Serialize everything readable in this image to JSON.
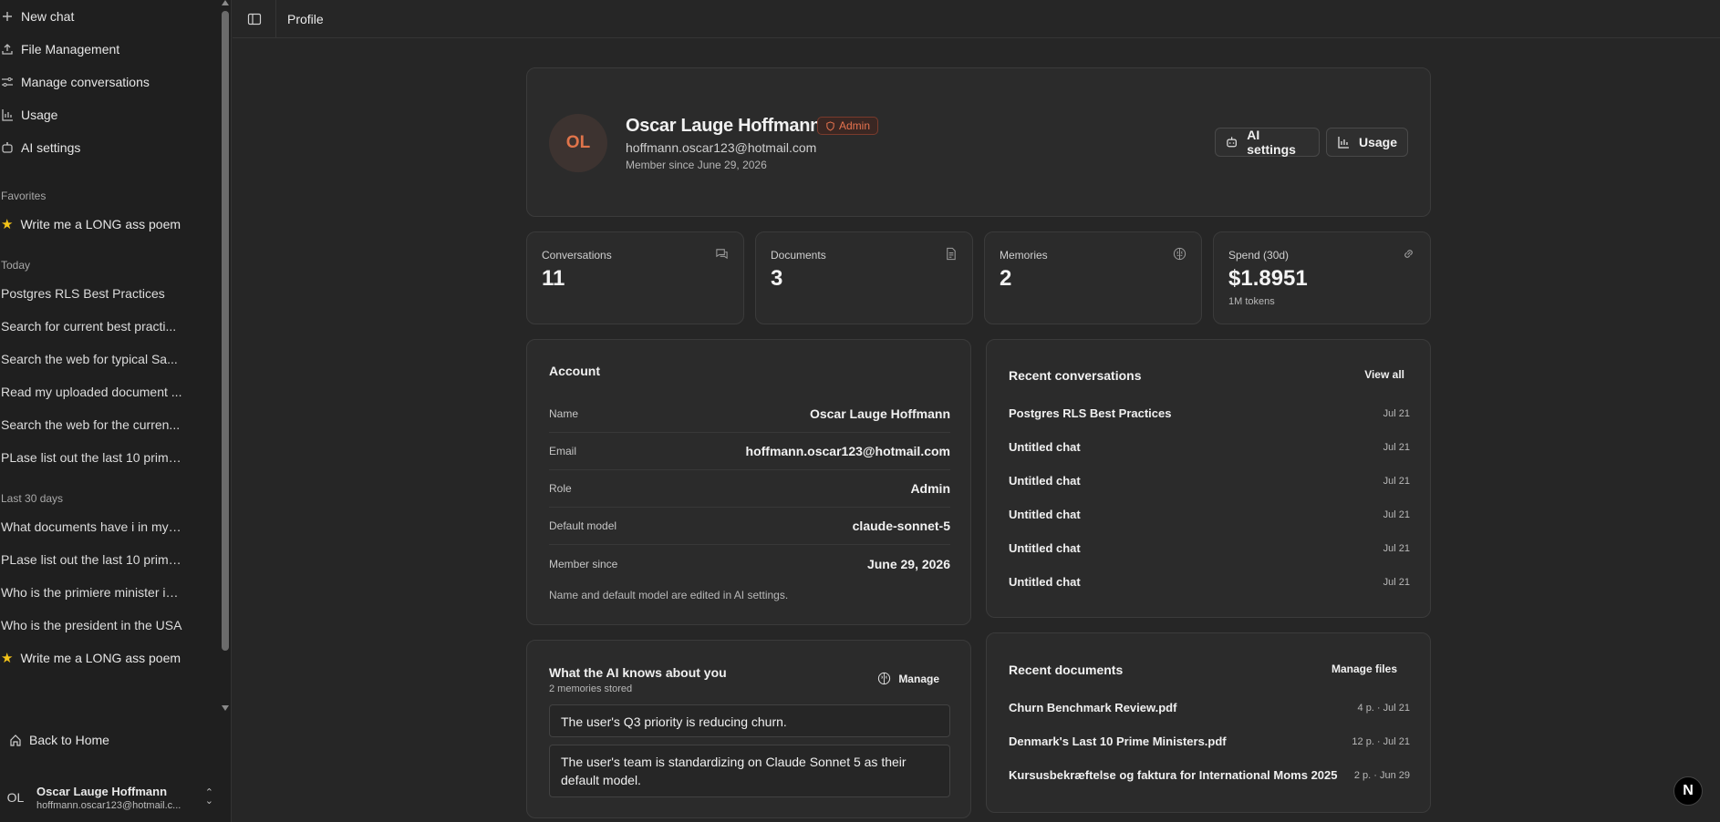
{
  "sidebar": {
    "nav": [
      {
        "label": "New chat",
        "icon": "plus-icon"
      },
      {
        "label": "File Management",
        "icon": "upload-icon"
      },
      {
        "label": "Manage conversations",
        "icon": "sliders-icon"
      },
      {
        "label": "Usage",
        "icon": "bar-chart-icon"
      },
      {
        "label": "AI settings",
        "icon": "bot-icon"
      }
    ],
    "favorites_heading": "Favorites",
    "favorites": [
      "Write me a LONG ass poem"
    ],
    "today_heading": "Today",
    "today": [
      "Postgres RLS Best Practices",
      "Search for current best practi...",
      "Search the web for typical Sa...",
      "Read my uploaded document ...",
      "Search the web for the curren...",
      "PLase list out the last 10 prime..."
    ],
    "last30_heading": "Last 30 days",
    "last30": [
      "What documents have i in my ...",
      "PLase list out the last 10 prime...",
      "Who is the primiere minister in...",
      "Who is the president in the USA"
    ],
    "last30_starred": "Write me a LONG ass poem",
    "back_home": "Back to Home",
    "user": {
      "initials": "OL",
      "name": "Oscar Lauge Hoffmann",
      "email": "hoffmann.oscar123@hotmail.c..."
    }
  },
  "topbar": {
    "title": "Profile"
  },
  "profile": {
    "initials": "OL",
    "name": "Oscar Lauge Hoffmann",
    "badge": "Admin",
    "email": "hoffmann.oscar123@hotmail.com",
    "member_since": "Member since June 29, 2026",
    "ai_settings_label": "AI settings",
    "usage_label": "Usage"
  },
  "stats": [
    {
      "label": "Conversations",
      "value": "11",
      "sub": "",
      "icon": "chat-icon"
    },
    {
      "label": "Documents",
      "value": "3",
      "sub": "",
      "icon": "document-icon"
    },
    {
      "label": "Memories",
      "value": "2",
      "sub": "",
      "icon": "brain-icon"
    },
    {
      "label": "Spend (30d)",
      "value": "$1.8951",
      "sub": "1M tokens",
      "icon": "link-icon"
    }
  ],
  "account": {
    "title": "Account",
    "rows": [
      {
        "label": "Name",
        "value": "Oscar Lauge Hoffmann"
      },
      {
        "label": "Email",
        "value": "hoffmann.oscar123@hotmail.com"
      },
      {
        "label": "Role",
        "value": "Admin"
      },
      {
        "label": "Default model",
        "value": "claude-sonnet-5"
      },
      {
        "label": "Member since",
        "value": "June 29, 2026"
      }
    ],
    "note": "Name and default model are edited in AI settings."
  },
  "recent_conversations": {
    "title": "Recent conversations",
    "view_all": "View all",
    "items": [
      {
        "name": "Postgres RLS Best Practices",
        "date": "Jul 21"
      },
      {
        "name": "Untitled chat",
        "date": "Jul 21"
      },
      {
        "name": "Untitled chat",
        "date": "Jul 21"
      },
      {
        "name": "Untitled chat",
        "date": "Jul 21"
      },
      {
        "name": "Untitled chat",
        "date": "Jul 21"
      },
      {
        "name": "Untitled chat",
        "date": "Jul 21"
      }
    ]
  },
  "ai_knowledge": {
    "title": "What the AI knows about you",
    "subtitle": "2 memories stored",
    "manage_label": "Manage",
    "memories": [
      "The user's Q3 priority is reducing churn.",
      "The user's team is standardizing on Claude Sonnet 5 as their default model."
    ]
  },
  "recent_documents": {
    "title": "Recent documents",
    "manage_label": "Manage files",
    "items": [
      {
        "name": "Churn Benchmark Review.pdf",
        "meta": "4 p. · Jul 21"
      },
      {
        "name": "Denmark's Last 10 Prime Ministers.pdf",
        "meta": "12 p. · Jul 21"
      },
      {
        "name": "Kursusbekræftelse og faktura for International Moms 2025",
        "meta": "2 p. · Jun 29"
      }
    ]
  },
  "floating_badge": "N",
  "colors": {
    "accent": "#e7734f",
    "star": "#f3c318",
    "background": "#262626"
  }
}
